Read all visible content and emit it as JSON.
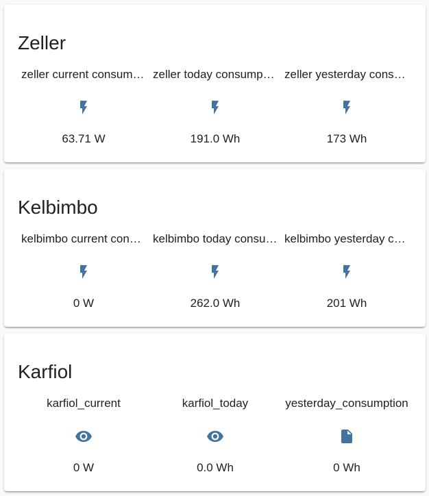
{
  "accent_color": "#44739e",
  "cards": [
    {
      "title": "Zeller",
      "entities": [
        {
          "name": "zeller current consumption",
          "icon": "flash-icon",
          "state": "63.71 W"
        },
        {
          "name": "zeller today consumption",
          "icon": "flash-icon",
          "state": "191.0 Wh"
        },
        {
          "name": "zeller yesterday consumption",
          "icon": "flash-icon",
          "state": "173 Wh"
        }
      ]
    },
    {
      "title": "Kelbimbo",
      "entities": [
        {
          "name": "kelbimbo current consumption",
          "icon": "flash-icon",
          "state": "0 W"
        },
        {
          "name": "kelbimbo today consumption",
          "icon": "flash-icon",
          "state": "262.0 Wh"
        },
        {
          "name": "kelbimbo yesterday consumption",
          "icon": "flash-icon",
          "state": "201 Wh"
        }
      ]
    },
    {
      "title": "Karfiol",
      "entities": [
        {
          "name": "karfiol_current",
          "icon": "eye-icon",
          "state": "0 W"
        },
        {
          "name": "karfiol_today",
          "icon": "eye-icon",
          "state": "0.0 Wh"
        },
        {
          "name": "yesterday_consumption",
          "icon": "file-icon",
          "state": "0 Wh"
        }
      ]
    }
  ]
}
